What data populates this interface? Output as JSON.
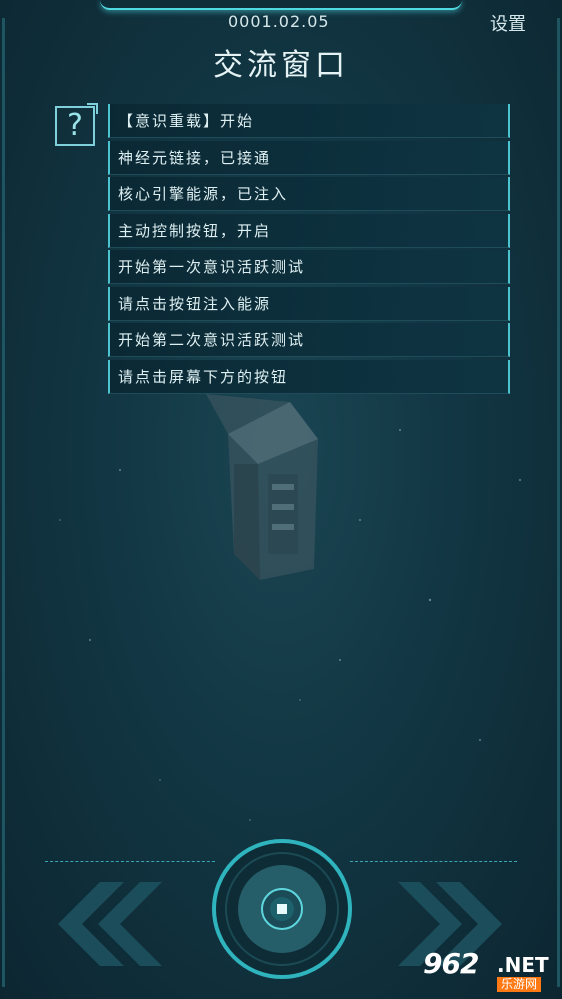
{
  "header": {
    "date": "0001.02.05",
    "settings_label": "设置",
    "title": "交流窗口"
  },
  "help": {
    "icon": "question-mark-icon",
    "glyph": "?"
  },
  "messages": [
    "【意识重载】开始",
    "神经元链接，已接通",
    "核心引擎能源，已注入",
    "主动控制按钮，开启",
    "开始第一次意识活跃测试",
    "请点击按钮注入能源",
    "开始第二次意识活跃测试",
    "请点击屏幕下方的按钮"
  ],
  "controls": {
    "left_icon": "double-chevron-left-icon",
    "right_icon": "double-chevron-right-icon",
    "core_icon": "core-button-icon"
  },
  "watermark": {
    "numbers": "962",
    "suffix": ".NET",
    "subtitle": "乐游网"
  },
  "colors": {
    "accent": "#4fd8e0",
    "background": "#123643"
  }
}
